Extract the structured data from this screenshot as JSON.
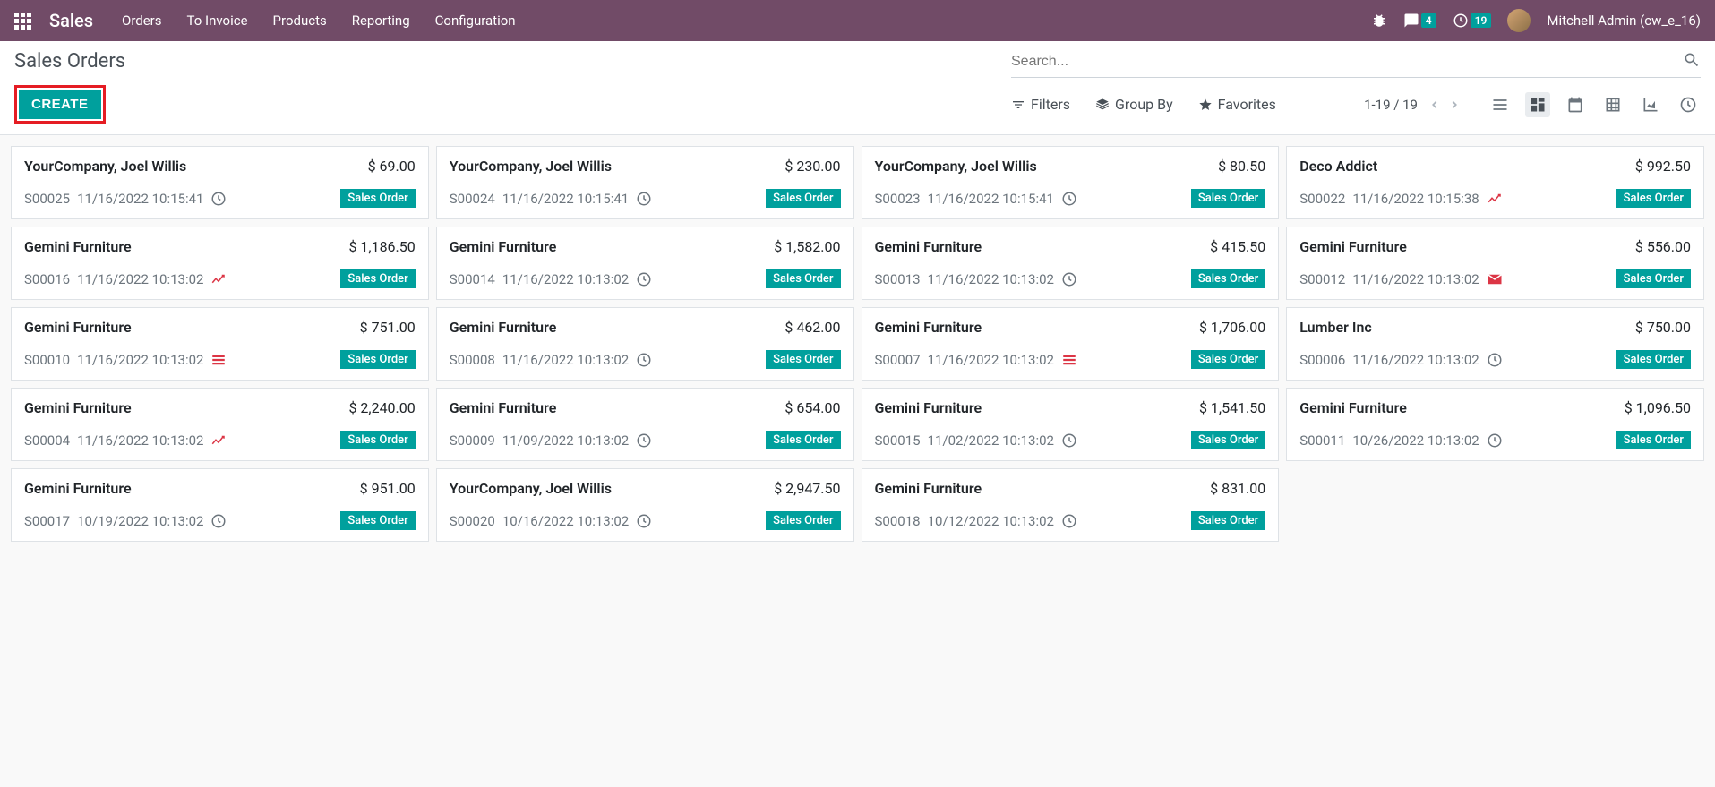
{
  "navbar": {
    "brand": "Sales",
    "links": [
      "Orders",
      "To Invoice",
      "Products",
      "Reporting",
      "Configuration"
    ],
    "chat_badge": "4",
    "clock_badge": "19",
    "username": "Mitchell Admin (cw_e_16)"
  },
  "control": {
    "breadcrumb": "Sales Orders",
    "search_placeholder": "Search...",
    "create_label": "CREATE",
    "filters_label": "Filters",
    "groupby_label": "Group By",
    "favorites_label": "Favorites",
    "pager": "1-19 / 19"
  },
  "cards": [
    {
      "customer": "YourCompany, Joel Willis",
      "amount": "$ 69.00",
      "ref": "S00025",
      "date": "11/16/2022 10:15:41",
      "icon": "clock",
      "status": "Sales Order"
    },
    {
      "customer": "YourCompany, Joel Willis",
      "amount": "$ 230.00",
      "ref": "S00024",
      "date": "11/16/2022 10:15:41",
      "icon": "clock",
      "status": "Sales Order"
    },
    {
      "customer": "YourCompany, Joel Willis",
      "amount": "$ 80.50",
      "ref": "S00023",
      "date": "11/16/2022 10:15:41",
      "icon": "clock",
      "status": "Sales Order"
    },
    {
      "customer": "Deco Addict",
      "amount": "$ 992.50",
      "ref": "S00022",
      "date": "11/16/2022 10:15:38",
      "icon": "chart",
      "status": "Sales Order"
    },
    {
      "customer": "Gemini Furniture",
      "amount": "$ 1,186.50",
      "ref": "S00016",
      "date": "11/16/2022 10:13:02",
      "icon": "chart",
      "status": "Sales Order"
    },
    {
      "customer": "Gemini Furniture",
      "amount": "$ 1,582.00",
      "ref": "S00014",
      "date": "11/16/2022 10:13:02",
      "icon": "clock",
      "status": "Sales Order"
    },
    {
      "customer": "Gemini Furniture",
      "amount": "$ 415.50",
      "ref": "S00013",
      "date": "11/16/2022 10:13:02",
      "icon": "clock",
      "status": "Sales Order"
    },
    {
      "customer": "Gemini Furniture",
      "amount": "$ 556.00",
      "ref": "S00012",
      "date": "11/16/2022 10:13:02",
      "icon": "mail",
      "status": "Sales Order"
    },
    {
      "customer": "Gemini Furniture",
      "amount": "$ 751.00",
      "ref": "S00010",
      "date": "11/16/2022 10:13:02",
      "icon": "bars",
      "status": "Sales Order"
    },
    {
      "customer": "Gemini Furniture",
      "amount": "$ 462.00",
      "ref": "S00008",
      "date": "11/16/2022 10:13:02",
      "icon": "clock",
      "status": "Sales Order"
    },
    {
      "customer": "Gemini Furniture",
      "amount": "$ 1,706.00",
      "ref": "S00007",
      "date": "11/16/2022 10:13:02",
      "icon": "bars",
      "status": "Sales Order"
    },
    {
      "customer": "Lumber Inc",
      "amount": "$ 750.00",
      "ref": "S00006",
      "date": "11/16/2022 10:13:02",
      "icon": "clock",
      "status": "Sales Order"
    },
    {
      "customer": "Gemini Furniture",
      "amount": "$ 2,240.00",
      "ref": "S00004",
      "date": "11/16/2022 10:13:02",
      "icon": "chart",
      "status": "Sales Order"
    },
    {
      "customer": "Gemini Furniture",
      "amount": "$ 654.00",
      "ref": "S00009",
      "date": "11/09/2022 10:13:02",
      "icon": "clock",
      "status": "Sales Order"
    },
    {
      "customer": "Gemini Furniture",
      "amount": "$ 1,541.50",
      "ref": "S00015",
      "date": "11/02/2022 10:13:02",
      "icon": "clock",
      "status": "Sales Order"
    },
    {
      "customer": "Gemini Furniture",
      "amount": "$ 1,096.50",
      "ref": "S00011",
      "date": "10/26/2022 10:13:02",
      "icon": "clock",
      "status": "Sales Order"
    },
    {
      "customer": "Gemini Furniture",
      "amount": "$ 951.00",
      "ref": "S00017",
      "date": "10/19/2022 10:13:02",
      "icon": "clock",
      "status": "Sales Order"
    },
    {
      "customer": "YourCompany, Joel Willis",
      "amount": "$ 2,947.50",
      "ref": "S00020",
      "date": "10/16/2022 10:13:02",
      "icon": "clock",
      "status": "Sales Order"
    },
    {
      "customer": "Gemini Furniture",
      "amount": "$ 831.00",
      "ref": "S00018",
      "date": "10/12/2022 10:13:02",
      "icon": "clock",
      "status": "Sales Order"
    }
  ]
}
